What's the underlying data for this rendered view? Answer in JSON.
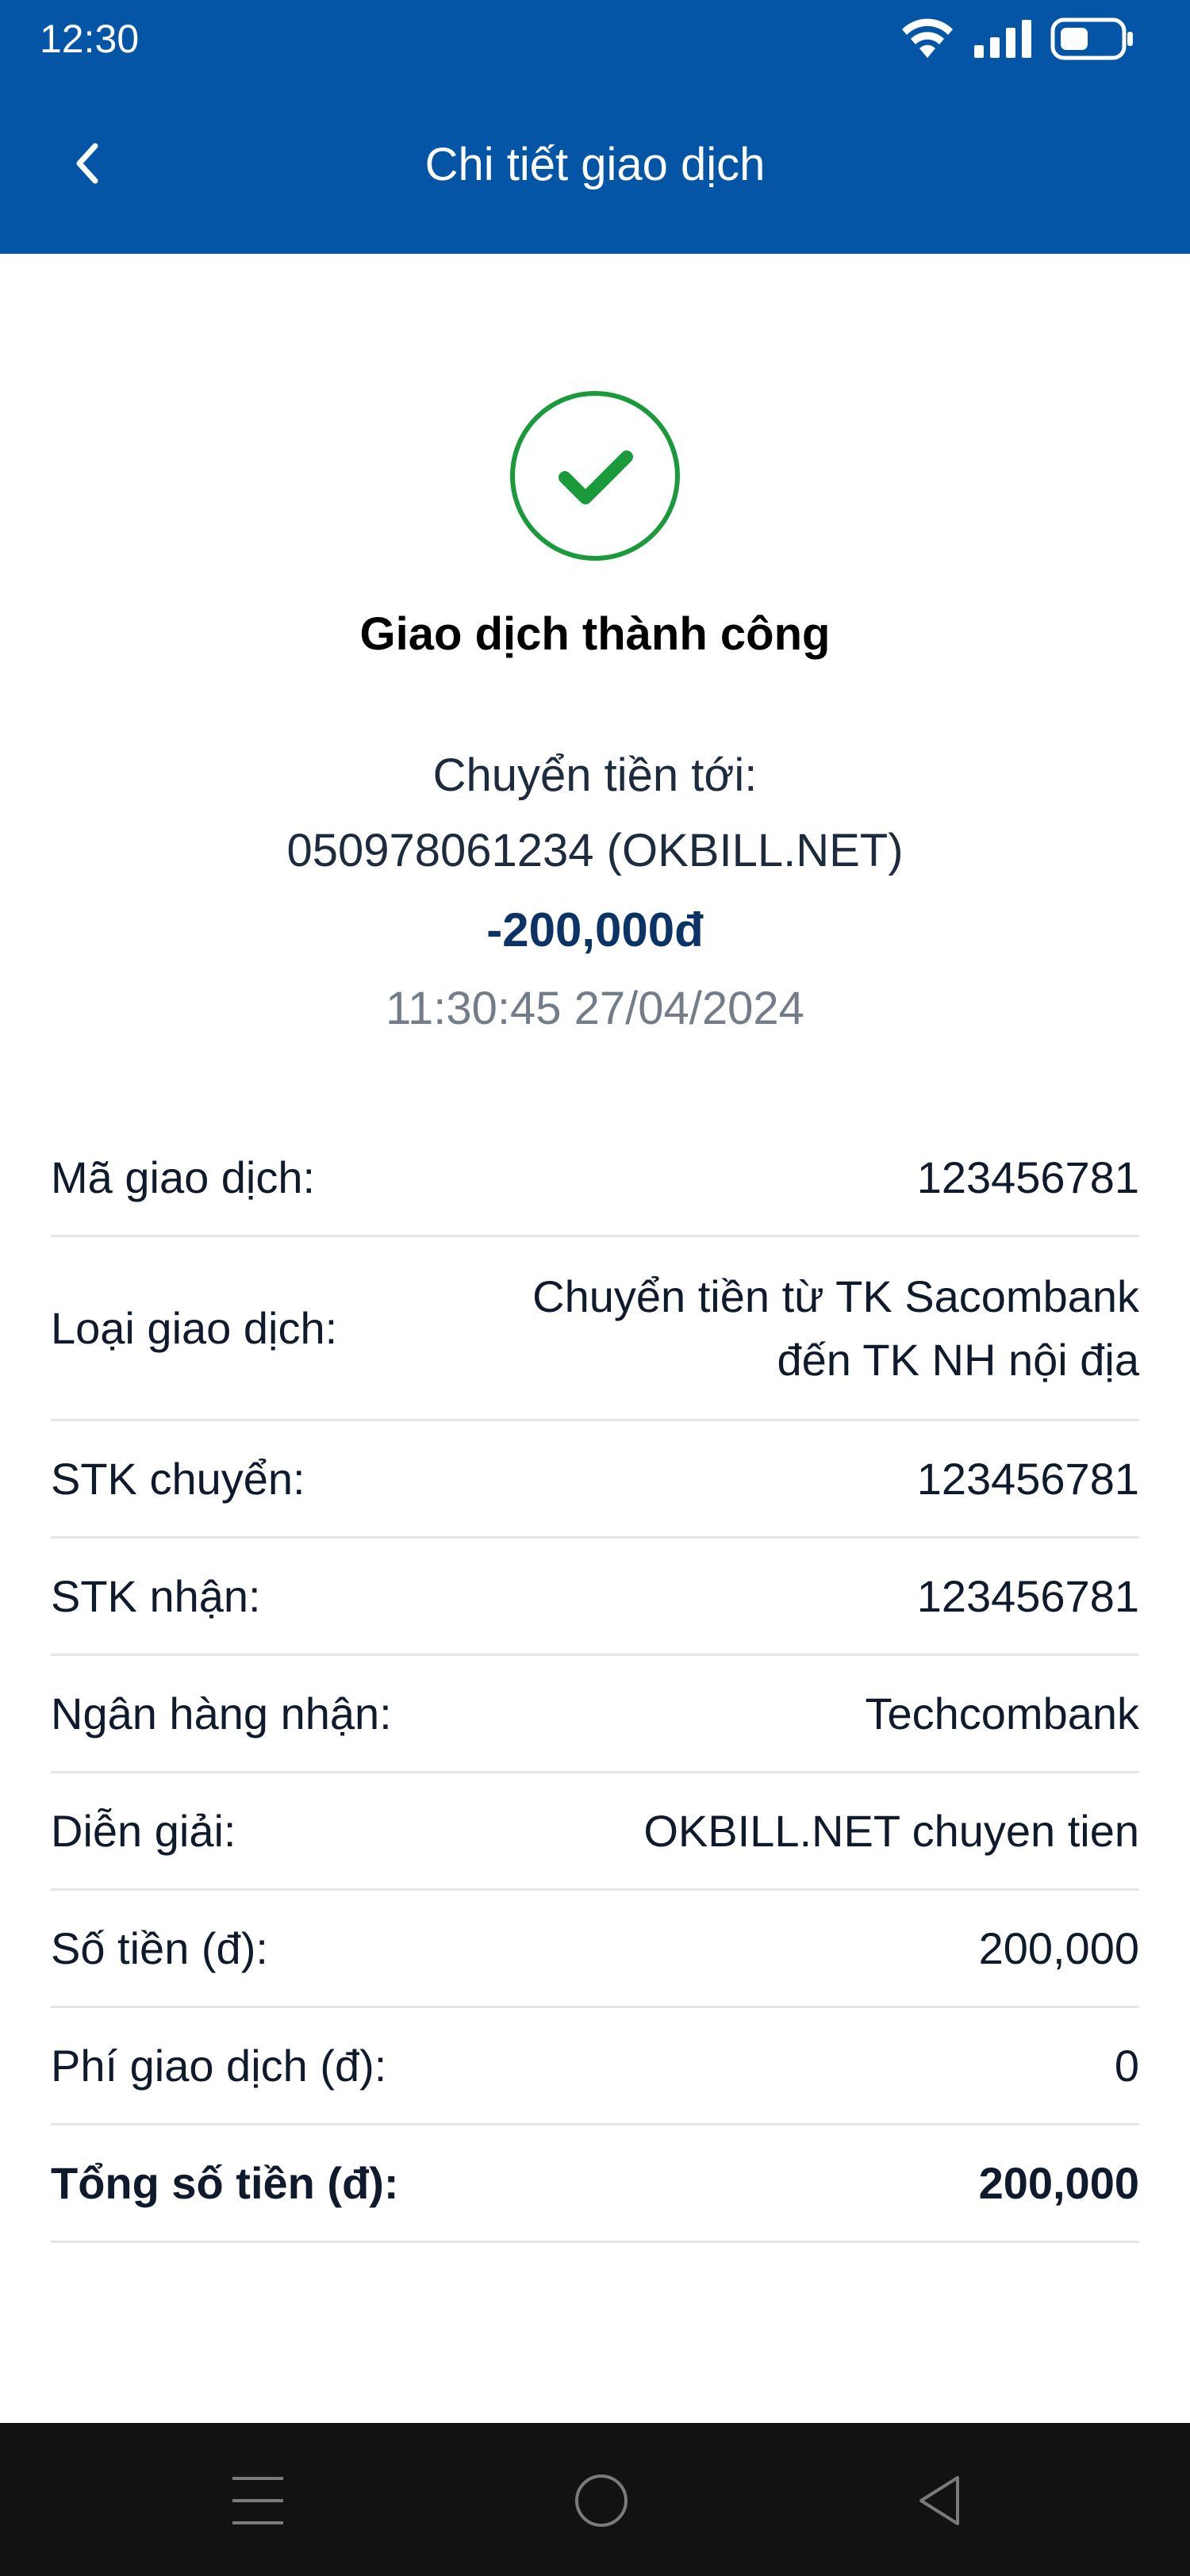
{
  "status_bar": {
    "time": "12:30"
  },
  "header": {
    "title": "Chi tiết giao dịch"
  },
  "summary": {
    "status": "Giao dịch thành công",
    "to_label": "Chuyển tiền tới:",
    "to_account": "050978061234 (OKBILL.NET)",
    "amount": "-200,000đ",
    "datetime": "11:30:45 27/04/2024"
  },
  "details": [
    {
      "label": "Mã giao dịch:",
      "value": "123456781"
    },
    {
      "label": "Loại giao dịch:",
      "value": "Chuyển tiền từ TK Sacombank",
      "value2": "đến TK NH nội địa"
    },
    {
      "label": "STK chuyển:",
      "value": "123456781"
    },
    {
      "label": "STK nhận:",
      "value": "123456781"
    },
    {
      "label": "Ngân hàng nhận:",
      "value": "Techcombank"
    },
    {
      "label": "Diễn giải:",
      "value": "OKBILL.NET chuyen tien"
    },
    {
      "label": "Số tiền (đ):",
      "value": "200,000"
    },
    {
      "label": "Phí giao dịch (đ):",
      "value": "0"
    },
    {
      "label": "Tổng số tiền (đ):",
      "value": "200,000"
    }
  ],
  "icons": {
    "status": [
      "wifi-icon",
      "signal-icon",
      "battery-icon"
    ],
    "header": "back-chevron-icon",
    "success": "check-circle-icon",
    "nav": [
      "menu-icon",
      "home-circle-icon",
      "back-triangle-icon"
    ]
  },
  "colors": {
    "header_bg": "#0455a6",
    "success_green": "#1a9a3a",
    "amount_navy": "#0c3366",
    "datetime_gray": "#737d8a",
    "navbar_bg": "#121212"
  }
}
